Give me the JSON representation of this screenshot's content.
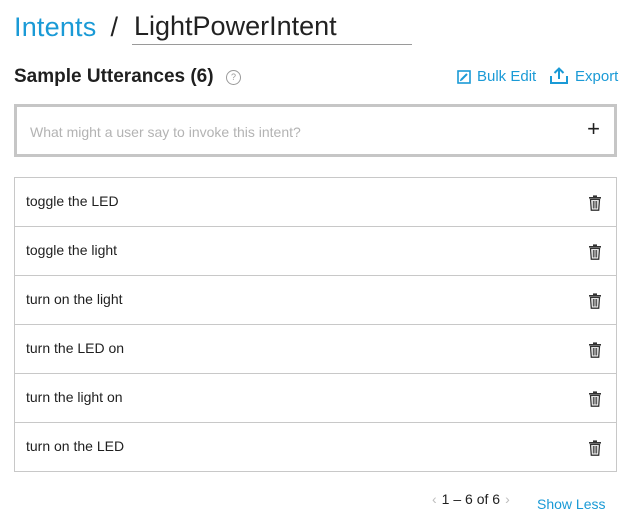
{
  "header": {
    "breadcrumb_link": "Intents",
    "separator": "/",
    "intent_name": "LightPowerIntent"
  },
  "section": {
    "title": "Sample Utterances (6)",
    "help_glyph": "?",
    "bulk_edit_label": "Bulk Edit",
    "export_label": "Export"
  },
  "utterance_input": {
    "placeholder": "What might a user say to invoke this intent?",
    "value": "",
    "add_glyph": "+"
  },
  "utterances": [
    {
      "text": "toggle the LED"
    },
    {
      "text": "toggle the light"
    },
    {
      "text": "turn on the light"
    },
    {
      "text": "turn the LED on"
    },
    {
      "text": "turn the light on"
    },
    {
      "text": "turn on the LED"
    }
  ],
  "pagination": {
    "prev_glyph": "‹",
    "range": "1 – 6 of 6",
    "next_glyph": "›",
    "show_less_label": "Show Less"
  },
  "colors": {
    "accent": "#1a9ad6",
    "border": "#c8c8c8",
    "input_border": "#c6c6c6",
    "muted": "#b3b3b3"
  },
  "icons": {
    "help": "help-icon",
    "bulk_edit": "bulk-edit-icon",
    "export": "export-icon",
    "add": "plus-icon",
    "delete": "trash-icon",
    "prev": "chevron-left-icon",
    "next": "chevron-right-icon"
  }
}
